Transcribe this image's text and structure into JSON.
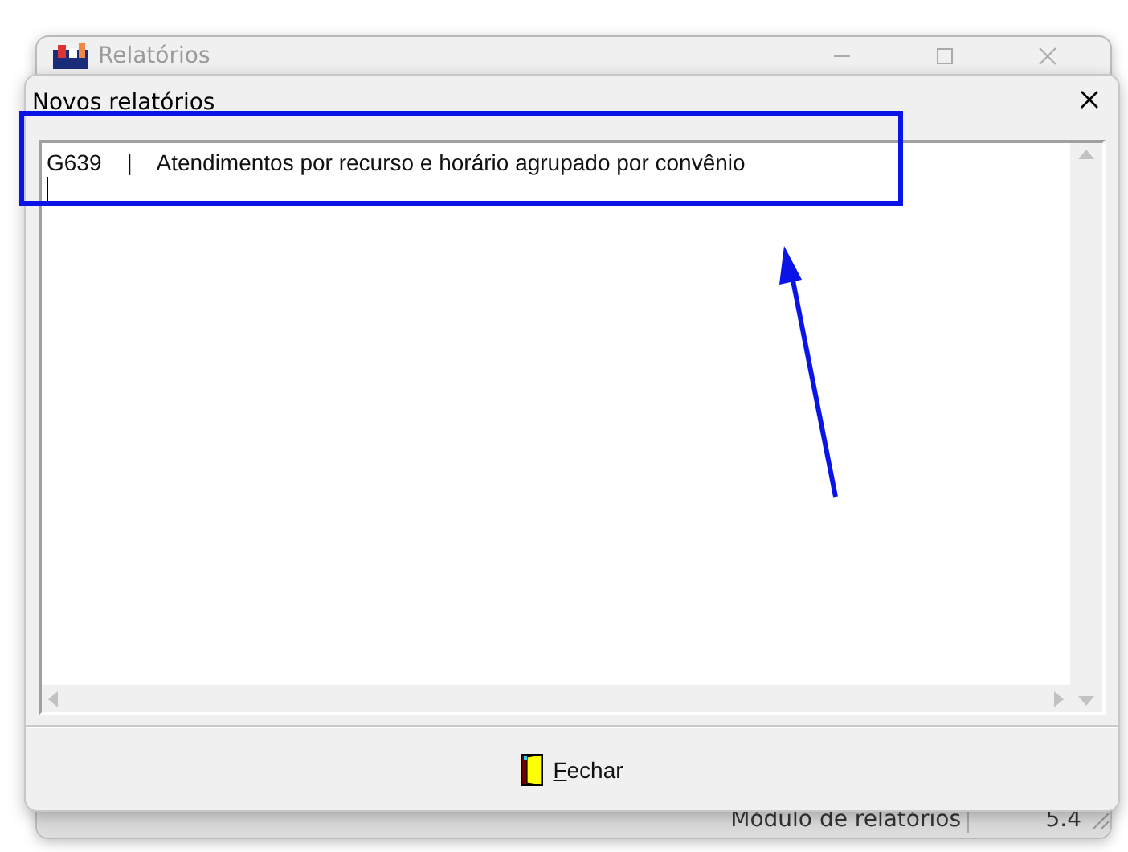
{
  "back_window": {
    "title": "Relatórios",
    "status_bar": [
      "Módulo de relatórios",
      "5.4"
    ]
  },
  "dialog": {
    "title": "Novos relatórios",
    "lines": [
      "G639    |    Atendimentos por recurso e horário agrupado por convênio"
    ],
    "buttons": [
      {
        "label": "Fechar",
        "kind": "close"
      }
    ]
  },
  "annotations": {
    "highlight_box": true,
    "arrow": true
  }
}
